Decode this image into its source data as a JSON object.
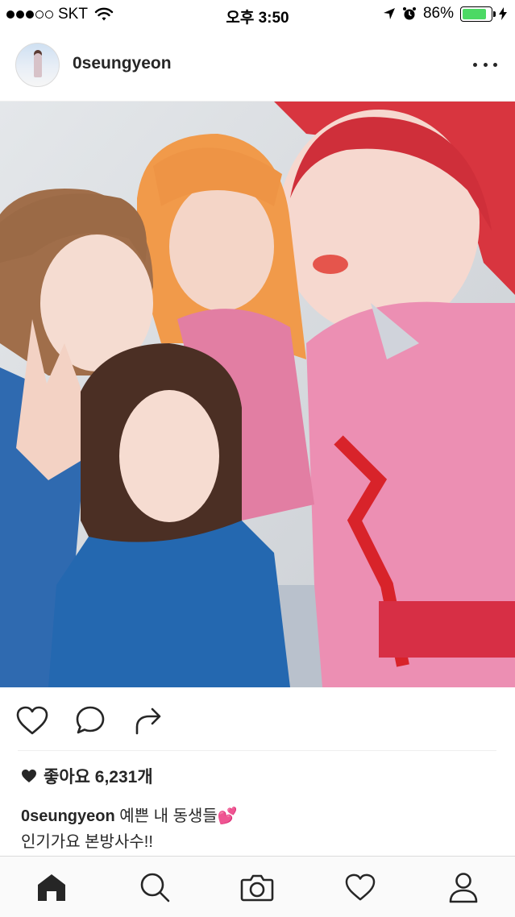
{
  "status_bar": {
    "carrier": "SKT",
    "time": "오후 3:50",
    "battery_percent": "86%",
    "battery_level": 0.86,
    "signal_bars_filled": 3,
    "signal_bars_total": 5
  },
  "post": {
    "username": "0seungyeon",
    "photo_alt": "",
    "likes_label": "좋아요 6,231개",
    "caption_username": "0seungyeon",
    "caption_text": "예쁜 내 동생들💕",
    "caption_line2": "인기가요 본방사수!!"
  },
  "colors": {
    "text": "#262626",
    "battery": "#4cd964",
    "divider": "#efefef"
  },
  "icons": {
    "actions": [
      "heart-icon",
      "comment-icon",
      "share-icon"
    ],
    "tabs": [
      "home-icon",
      "search-icon",
      "camera-icon",
      "heart-icon",
      "profile-icon"
    ]
  }
}
